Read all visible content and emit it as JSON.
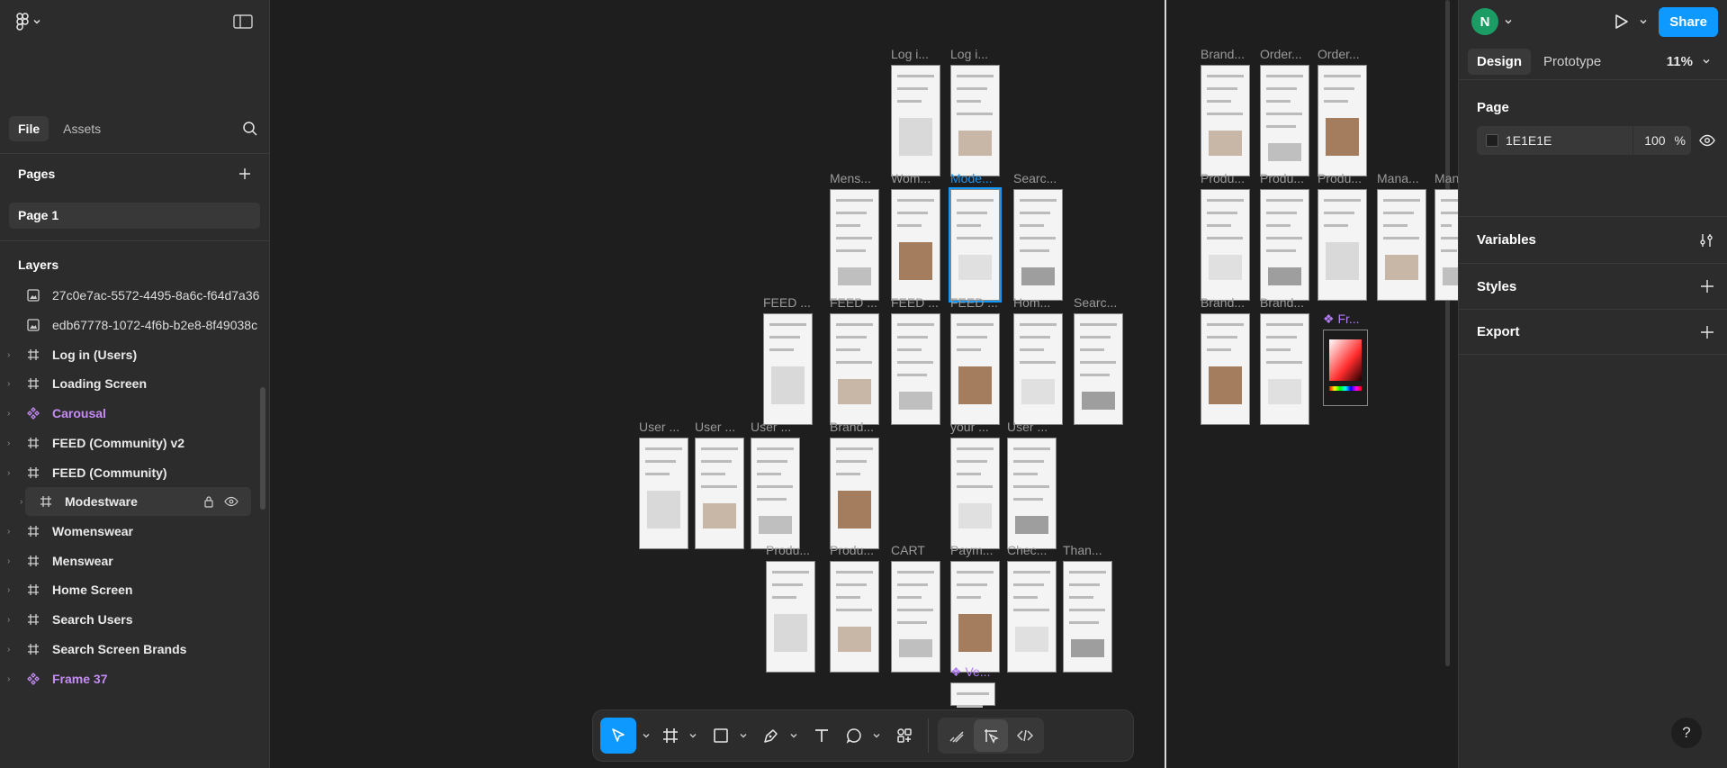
{
  "left_panel": {
    "tabs": [
      "File",
      "Assets"
    ],
    "pages_title": "Pages",
    "page_item": "Page 1",
    "layers_title": "Layers",
    "layers": [
      {
        "label": "27c0e7ac-5572-4495-8a6c-f64d7a36",
        "kind": "image"
      },
      {
        "label": "edb67778-1072-4f6b-b2e8-8f49038c",
        "kind": "image"
      },
      {
        "label": "Log in (Users)",
        "kind": "frame"
      },
      {
        "label": "Loading Screen",
        "kind": "frame"
      },
      {
        "label": "Carousal",
        "kind": "component"
      },
      {
        "label": "FEED (Community) v2",
        "kind": "frame"
      },
      {
        "label": "FEED (Community)",
        "kind": "frame"
      },
      {
        "label": "Modestware",
        "kind": "frame",
        "selected": true
      },
      {
        "label": "Womenswear",
        "kind": "frame"
      },
      {
        "label": "Menswear",
        "kind": "frame"
      },
      {
        "label": "Home Screen",
        "kind": "frame"
      },
      {
        "label": "Search Users",
        "kind": "frame"
      },
      {
        "label": "Search Screen Brands",
        "kind": "frame"
      },
      {
        "label": "Frame 37",
        "kind": "component"
      }
    ]
  },
  "canvas": {
    "frames": [
      {
        "title": "Log i...",
        "style": "normal"
      },
      {
        "title": "Log i...",
        "style": "normal"
      },
      {
        "title": "Mens...",
        "style": "normal"
      },
      {
        "title": "Wom...",
        "style": "normal"
      },
      {
        "title": "Mode...",
        "style": "selected"
      },
      {
        "title": "Searc...",
        "style": "normal"
      },
      {
        "title": "FEED ...",
        "style": "normal"
      },
      {
        "title": "FEED ...",
        "style": "normal"
      },
      {
        "title": "FEED ...",
        "style": "normal"
      },
      {
        "title": "FEED ...",
        "style": "normal"
      },
      {
        "title": "Hom...",
        "style": "normal"
      },
      {
        "title": "Searc...",
        "style": "normal"
      },
      {
        "title": "User ...",
        "style": "normal"
      },
      {
        "title": "User ...",
        "style": "normal"
      },
      {
        "title": "User ...",
        "style": "normal"
      },
      {
        "title": "Brand...",
        "style": "normal"
      },
      {
        "title": "your ...",
        "style": "normal"
      },
      {
        "title": "User ...",
        "style": "normal"
      },
      {
        "title": "Produ...",
        "style": "normal"
      },
      {
        "title": "Produ...",
        "style": "normal"
      },
      {
        "title": "CART",
        "style": "normal"
      },
      {
        "title": "Paym...",
        "style": "normal"
      },
      {
        "title": "Chec...",
        "style": "normal"
      },
      {
        "title": "Than...",
        "style": "normal"
      },
      {
        "title": "Ve...",
        "style": "component"
      },
      {
        "title": "Brand...",
        "style": "normal"
      },
      {
        "title": "Order...",
        "style": "normal"
      },
      {
        "title": "Order...",
        "style": "normal"
      },
      {
        "title": "Produ...",
        "style": "normal"
      },
      {
        "title": "Produ...",
        "style": "normal"
      },
      {
        "title": "Produ...",
        "style": "normal"
      },
      {
        "title": "Mana...",
        "style": "normal"
      },
      {
        "title": "Man",
        "style": "normal"
      },
      {
        "title": "Brand...",
        "style": "normal"
      },
      {
        "title": "Brand...",
        "style": "normal"
      },
      {
        "title": "Fr...",
        "style": "component"
      }
    ]
  },
  "toolbar": {
    "tools": [
      "move-tool",
      "frame-tool",
      "shape-tool",
      "pen-tool",
      "text-tool",
      "comment-tool",
      "actions-tool"
    ],
    "modes": [
      "draw-mode",
      "design-mode",
      "dev-mode"
    ]
  },
  "right_panel": {
    "avatar_initial": "N",
    "share_label": "Share",
    "tabs": [
      "Design",
      "Prototype"
    ],
    "zoom": "11%",
    "page_title": "Page",
    "bg_color": "1E1E1E",
    "bg_opacity": "100",
    "bg_opacity_unit": "%",
    "sections": [
      "Variables",
      "Styles",
      "Export"
    ],
    "help_label": "?"
  }
}
